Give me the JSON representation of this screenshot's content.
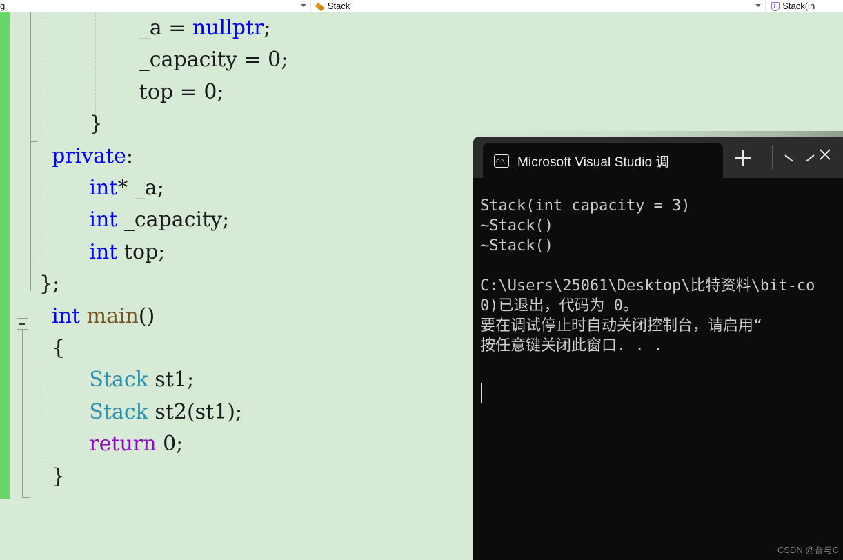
{
  "navbar": {
    "project_combo": {
      "text": "g",
      "caret": "chevron-down-icon"
    },
    "type_combo": {
      "icon": "class-icon",
      "text": "Stack",
      "caret": "chevron-down-icon"
    },
    "member_combo": {
      "icon": "method-icon",
      "text": "Stack(in"
    }
  },
  "editor": {
    "language": "cpp",
    "fold_marker": "collapse-minus-icon",
    "lines": [
      {
        "indent": 8,
        "tokens": [
          {
            "t": "_a = ",
            "c": "plain"
          },
          {
            "t": "nullptr",
            "c": "kw"
          },
          {
            "t": ";",
            "c": "plain"
          }
        ]
      },
      {
        "indent": 8,
        "tokens": [
          {
            "t": "_capacity = 0;",
            "c": "plain"
          }
        ]
      },
      {
        "indent": 8,
        "tokens": [
          {
            "t": "top = 0;",
            "c": "plain"
          }
        ]
      },
      {
        "indent": 4,
        "tokens": [
          {
            "t": "}",
            "c": "plain"
          }
        ]
      },
      {
        "indent": 1,
        "tokens": [
          {
            "t": "private",
            "c": "kw"
          },
          {
            "t": ":",
            "c": "plain"
          }
        ]
      },
      {
        "indent": 4,
        "tokens": [
          {
            "t": "int",
            "c": "kw"
          },
          {
            "t": "* _a;",
            "c": "plain"
          }
        ]
      },
      {
        "indent": 4,
        "tokens": [
          {
            "t": "int",
            "c": "kw"
          },
          {
            "t": " _capacity;",
            "c": "plain"
          }
        ]
      },
      {
        "indent": 4,
        "tokens": [
          {
            "t": "int",
            "c": "kw"
          },
          {
            "t": " top;",
            "c": "plain"
          }
        ]
      },
      {
        "indent": 0,
        "tokens": [
          {
            "t": "};",
            "c": "plain"
          }
        ]
      },
      {
        "indent": 1,
        "tokens": [
          {
            "t": "int",
            "c": "kw"
          },
          {
            "t": " ",
            "c": "plain"
          },
          {
            "t": "main",
            "c": "fn"
          },
          {
            "t": "()",
            "c": "plain"
          }
        ]
      },
      {
        "indent": 1,
        "tokens": [
          {
            "t": "{",
            "c": "plain"
          }
        ]
      },
      {
        "indent": 4,
        "tokens": [
          {
            "t": "Stack",
            "c": "type"
          },
          {
            "t": " st1;",
            "c": "plain"
          }
        ]
      },
      {
        "indent": 4,
        "tokens": [
          {
            "t": "Stack",
            "c": "type"
          },
          {
            "t": " st2(st1);",
            "c": "plain"
          }
        ]
      },
      {
        "indent": 4,
        "tokens": [
          {
            "t": "return",
            "c": "ctrl"
          },
          {
            "t": " 0;",
            "c": "plain"
          }
        ]
      },
      {
        "indent": 1,
        "tokens": [
          {
            "t": "}",
            "c": "plain"
          }
        ]
      }
    ]
  },
  "console": {
    "tab": {
      "icon": "console-terminal-icon",
      "title": "Microsoft Visual Studio 调试控制台",
      "close_label": "close-icon"
    },
    "toolbar": {
      "new_tab": "plus-icon",
      "dropdown": "chevron-down-icon"
    },
    "output": "Stack(int capacity = 3)\n~Stack()\n~Stack()\n\nC:\\Users\\25061\\Desktop\\比特资料\\bit-co\n0)已退出，代码为 0。\n要在调试停止时自动关闭控制台，请启用“\n按任意键关闭此窗口. . ."
  },
  "watermark": {
    "text": "CSDN @吾与C"
  },
  "colors": {
    "editor_background": "#d6ead6",
    "change_margin": "#68d668",
    "keyword": "#0000ff",
    "type": "#2b91af",
    "control": "#8f08c4",
    "function": "#74531f",
    "console_background": "#0c0c0c",
    "console_titlebar": "#2c2c2c",
    "console_text": "#cccccc"
  }
}
